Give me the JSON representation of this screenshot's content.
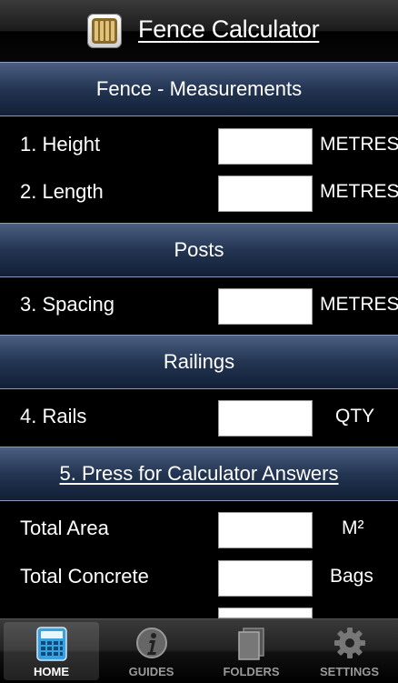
{
  "header": {
    "title": "Fence Calculator",
    "icon": "fence-app-icon"
  },
  "sections": {
    "measurements": "Fence - Measurements",
    "posts": "Posts",
    "railings": "Railings",
    "answers": "5. Press for Calculator Answers"
  },
  "inputs": {
    "height": {
      "label": "1. Height",
      "value": "",
      "unit": "METRES"
    },
    "length": {
      "label": "2. Length",
      "value": "",
      "unit": "METRES"
    },
    "spacing": {
      "label": "3. Spacing",
      "value": "",
      "unit": "METRES"
    },
    "rails": {
      "label": "4. Rails",
      "value": "",
      "unit": "QTY"
    }
  },
  "results": {
    "total_area": {
      "label": "Total Area",
      "value": "",
      "unit": "M²"
    },
    "total_concrete": {
      "label": "Total Concrete",
      "value": "",
      "unit": "Bags"
    }
  },
  "tabbar": {
    "active": "home",
    "tabs": [
      {
        "id": "home",
        "label": "HOME",
        "icon": "calculator-icon"
      },
      {
        "id": "guides",
        "label": "GUIDES",
        "icon": "info-icon"
      },
      {
        "id": "folders",
        "label": "FOLDERS",
        "icon": "folder-icon"
      },
      {
        "id": "settings",
        "label": "SETTINGS",
        "icon": "gear-icon"
      }
    ]
  },
  "colors": {
    "section_top": "#4c5f82",
    "section_bottom": "#121f36",
    "background": "#000000"
  }
}
